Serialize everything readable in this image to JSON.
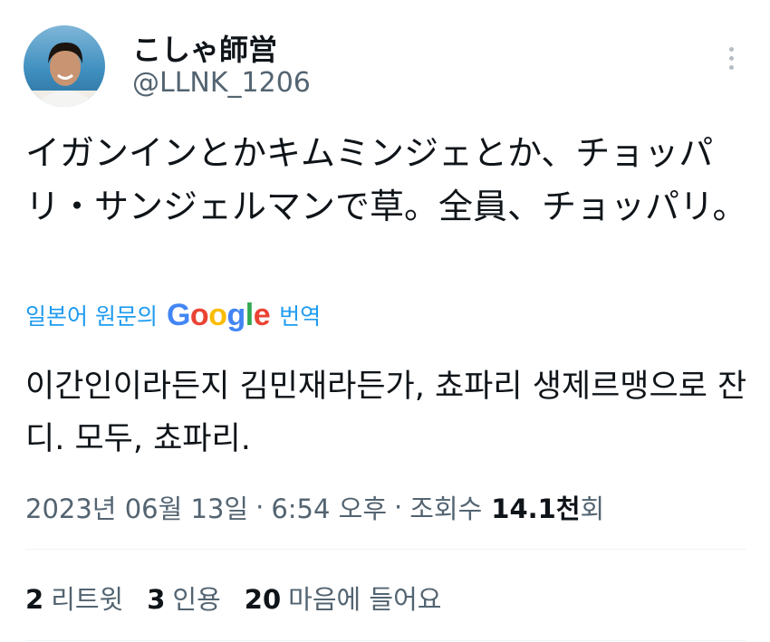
{
  "author": {
    "name": "こしゃ師営",
    "handle": "@LLNK_1206"
  },
  "tweet": {
    "text": "イガンインとかキムミンジェとか、チョッパリ・サンジェルマンで草。全員、チョッパリ。"
  },
  "translation": {
    "label_prefix": "일본어 원문의",
    "logo_letters": [
      "G",
      "o",
      "o",
      "g",
      "l",
      "e"
    ],
    "logo_colors": [
      "#4285F4",
      "#EA4335",
      "#FBBC05",
      "#4285F4",
      "#34A853",
      "#EA4335"
    ],
    "label_suffix": "번역",
    "text": "이간인이라든지 김민재라든가, 쵸파리 생제르맹으로 잔디. 모두, 쵸파리."
  },
  "meta": {
    "date": "2023년 06월 13일",
    "time": "6:54 오후",
    "separator": "·",
    "views_label": "조회수",
    "views_count": "14.1천",
    "views_suffix": "회"
  },
  "stats": [
    {
      "count": "2",
      "label": "리트윗"
    },
    {
      "count": "3",
      "label": "인용"
    },
    {
      "count": "20",
      "label": "마음에 들어요"
    }
  ],
  "colors": {
    "link": "#1d9bf0",
    "secondary_text": "#536471",
    "primary_text": "#0f1419"
  },
  "icons": {
    "more": "more-vertical-icon"
  }
}
